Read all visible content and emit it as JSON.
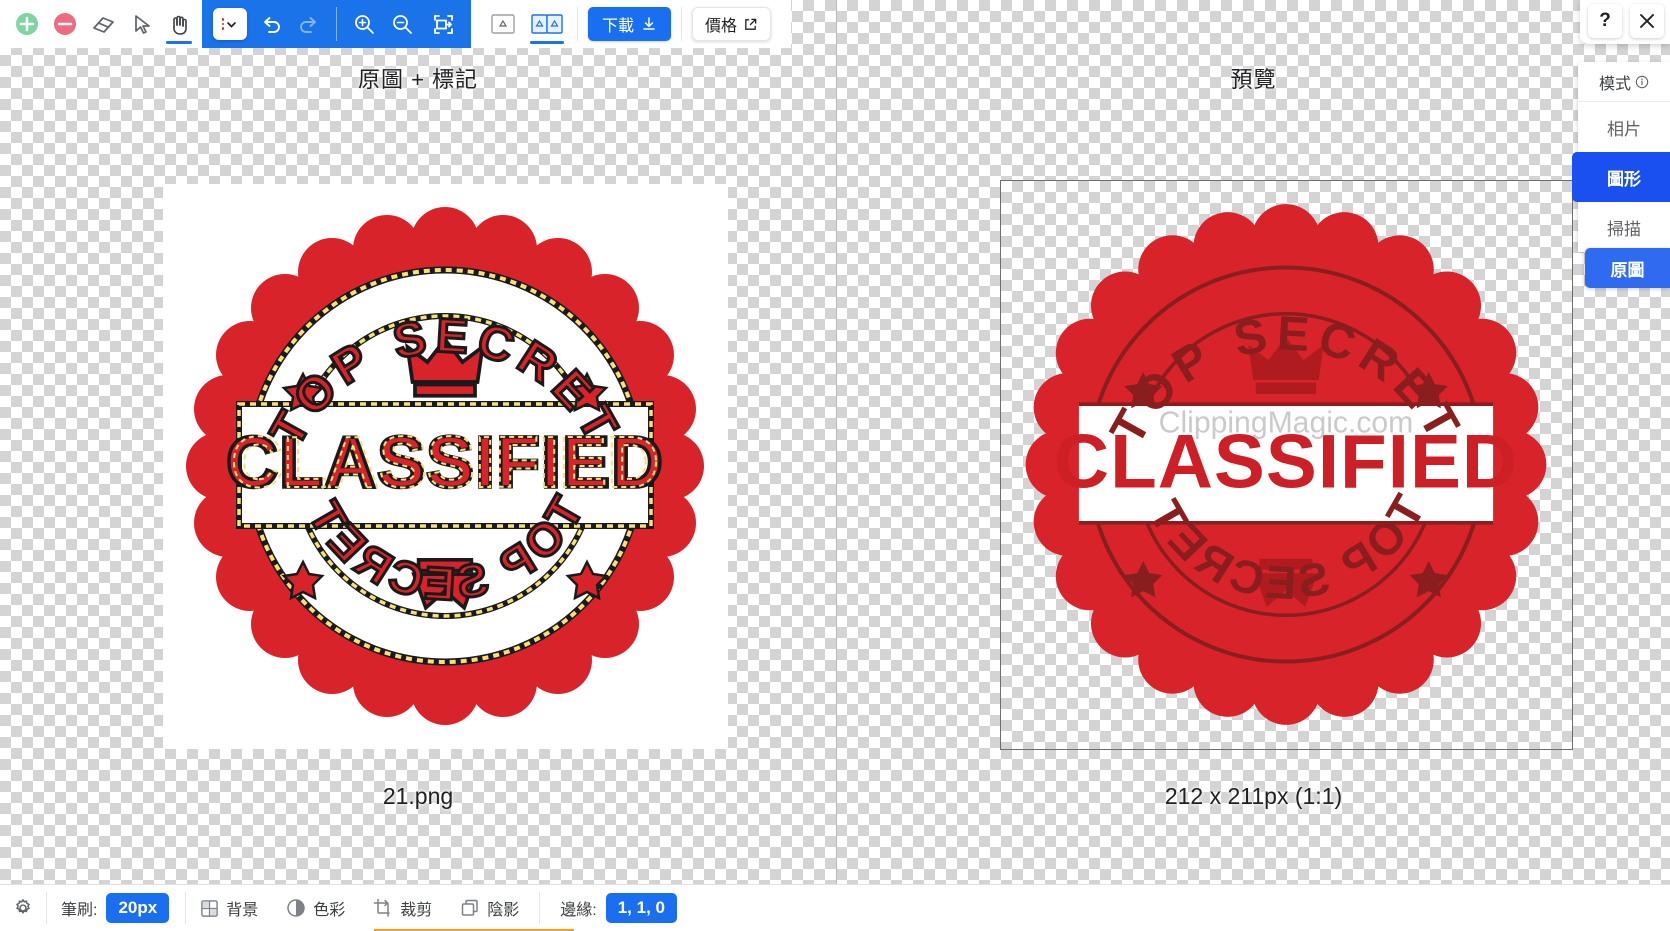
{
  "toolbar": {
    "tools": [
      {
        "name": "add-region-tool",
        "icon": "plus-circle-icon",
        "label": "+",
        "active": false
      },
      {
        "name": "remove-region-tool",
        "icon": "minus-circle-icon",
        "label": "-",
        "active": false
      },
      {
        "name": "eraser-tool",
        "icon": "eraser-icon",
        "label": "",
        "active": false
      },
      {
        "name": "select-tool",
        "icon": "cursor-arrow-icon",
        "label": "",
        "active": false
      },
      {
        "name": "pan-tool",
        "icon": "hand-icon",
        "label": "",
        "active": true
      }
    ],
    "menu_chip": {
      "icon": "more-options-chevron-icon"
    },
    "history": [
      {
        "name": "undo-button",
        "icon": "undo-arrow-icon",
        "enabled": true
      },
      {
        "name": "redo-button",
        "icon": "redo-arrow-icon",
        "enabled": false
      }
    ],
    "zoom_controls": [
      {
        "name": "zoom-in-button",
        "icon": "magnifier-plus-icon"
      },
      {
        "name": "zoom-out-button",
        "icon": "magnifier-minus-icon"
      },
      {
        "name": "fit-to-screen-button",
        "icon": "fit-screen-icon"
      }
    ],
    "view_modes": [
      {
        "name": "single-view-button",
        "icon": "single-pane-icon",
        "active": false
      },
      {
        "name": "split-view-button",
        "icon": "split-pane-icon",
        "active": true
      }
    ],
    "download_label": "下載",
    "download_icon": "download-arrow-icon",
    "pricing_label": "價格",
    "pricing_icon": "external-link-icon"
  },
  "panels": {
    "left": {
      "title": "原圖 + 標記",
      "caption": "21.png"
    },
    "right": {
      "title": "預覽",
      "caption": "212 x 211px (1:1)"
    }
  },
  "side": {
    "help_label": "?",
    "close_label": "✕",
    "mode_header": "模式",
    "mode_info_icon": "info-circle-icon",
    "modes": [
      {
        "label": "相片",
        "selected": false
      },
      {
        "label": "圖形",
        "selected": true
      },
      {
        "label": "掃描",
        "selected": false
      }
    ],
    "original_button_label": "原圖"
  },
  "bottombar": {
    "settings_icon": "gear-icon",
    "brush_label": "筆刷:",
    "brush_value": "20px",
    "tools": [
      {
        "label": "背景",
        "icon": "background-grid-icon"
      },
      {
        "label": "色彩",
        "icon": "contrast-circle-icon"
      },
      {
        "label": "裁剪",
        "icon": "crop-icon"
      },
      {
        "label": "陰影",
        "icon": "shadow-layers-icon"
      }
    ],
    "edge_label": "邊緣:",
    "edge_value": "1, 1, 0"
  },
  "stamp": {
    "top_text": "TOP SECRET",
    "center_text": "CLASSIFIED",
    "bottom_text": "TOP SECRET",
    "watermark": "ClippingMagic.com",
    "colors": {
      "red": "#d8232a",
      "dark_red": "#8a1d1d",
      "outline_yellow": "#f5e07a",
      "outline_black": "#1a1a1a"
    }
  },
  "colors": {
    "accent_blue": "#1a73e8",
    "button_blue": "#1a6ff0",
    "selected_blue": "#1a4ff0",
    "edge_orange": "#f0a030"
  }
}
